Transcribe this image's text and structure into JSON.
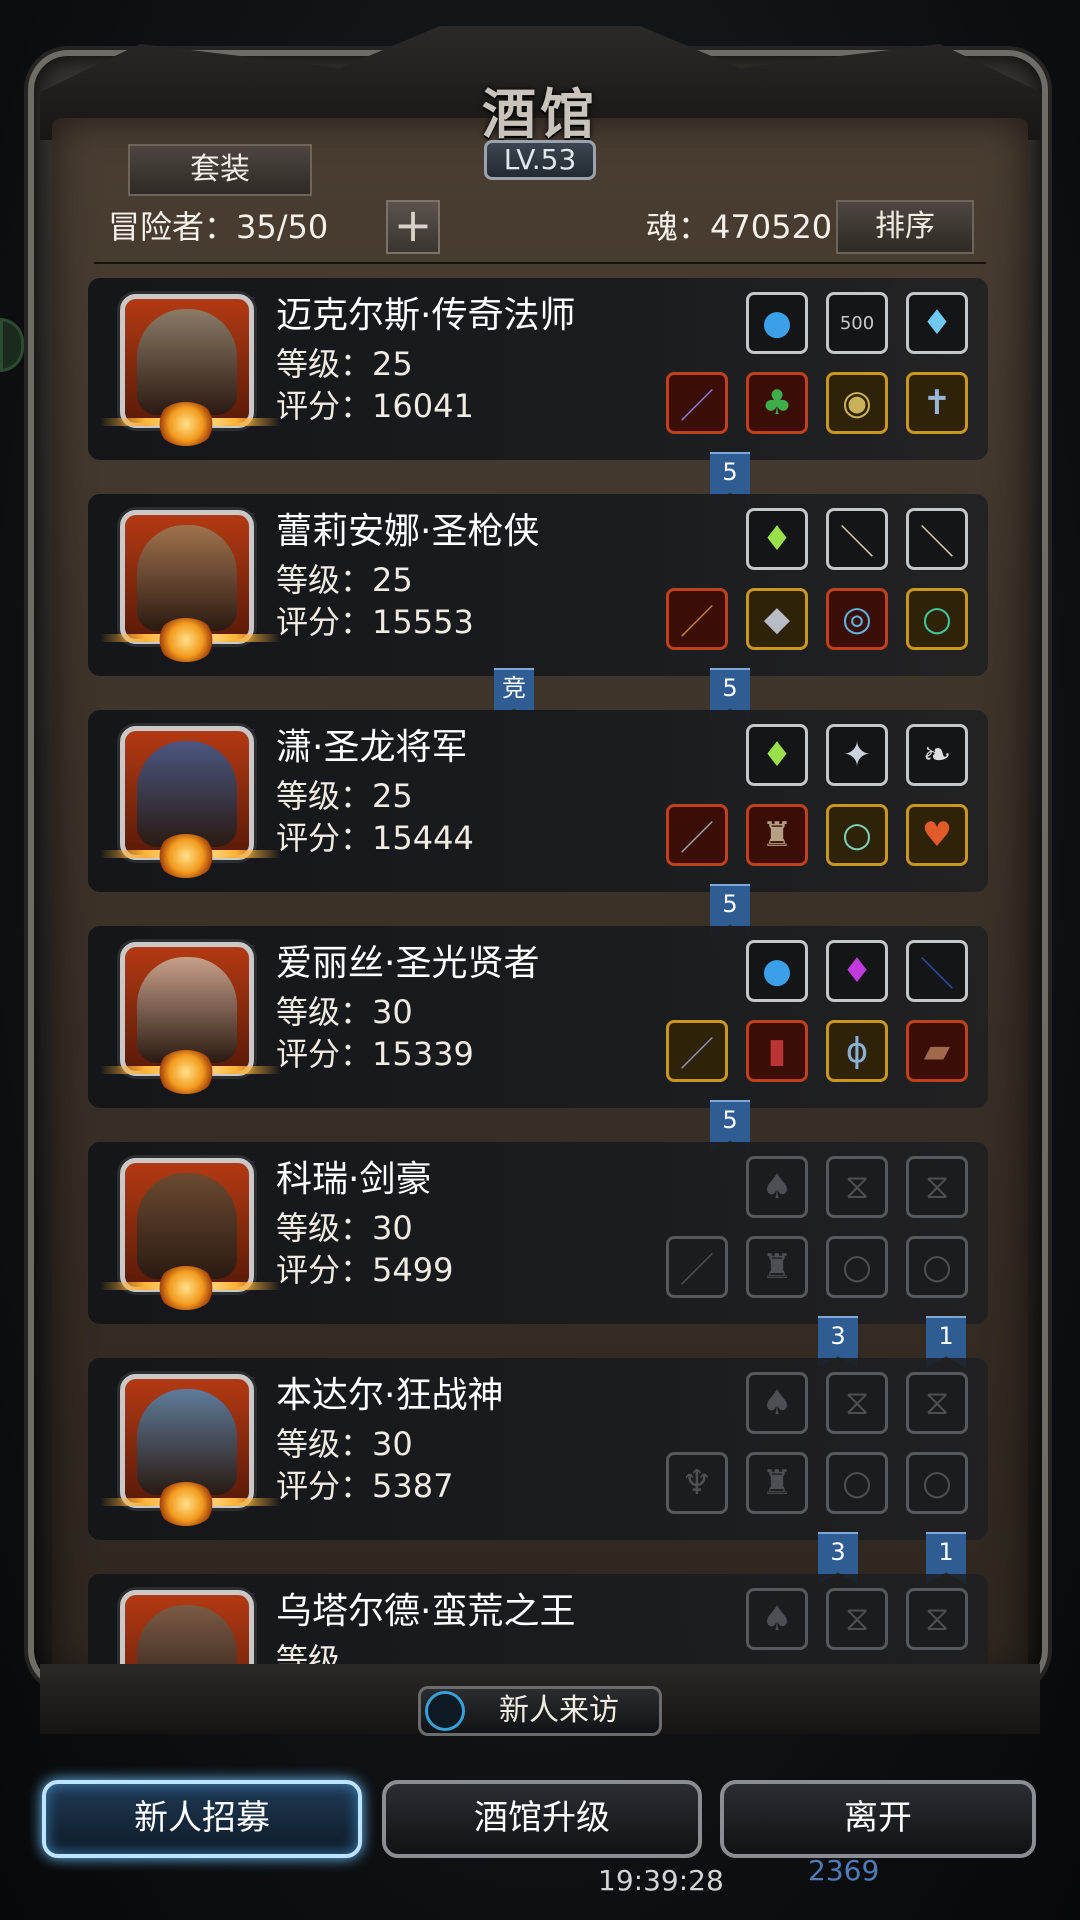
{
  "header": {
    "title": "酒馆",
    "level": "LV.53",
    "suit_button": "套装",
    "adventurers": "冒险者：35/50",
    "plus": "+",
    "soul": "魂：470520",
    "sort_button": "排序"
  },
  "heroes": [
    {
      "name": "迈克尔斯·传奇法师",
      "level": "等级：25",
      "score": "评分：16041",
      "face": "#8b7a66",
      "slots_top": [
        {
          "icon": "orb-icon",
          "glyph": "●",
          "style": "white",
          "color": "#3aa0e8"
        },
        {
          "icon": "badge-500-icon",
          "glyph": "500",
          "style": "white",
          "color": "#c9c9c9"
        },
        {
          "icon": "crystal-icon",
          "glyph": "♦",
          "style": "white",
          "color": "#6fc8f0"
        }
      ],
      "slots_bottom": [
        {
          "icon": "staff-icon",
          "glyph": "／",
          "style": "red",
          "color": "#8a7ad8"
        },
        {
          "icon": "robe-icon",
          "glyph": "♣",
          "style": "red",
          "color": "#3fae4a"
        },
        {
          "icon": "amulet-icon",
          "glyph": "◉",
          "style": "gold",
          "color": "#c9b25a"
        },
        {
          "icon": "cross-icon",
          "glyph": "✝",
          "style": "gold",
          "color": "#9bb5d6"
        }
      ],
      "ribbons": [
        "5"
      ]
    },
    {
      "name": "蕾莉安娜·圣枪侠",
      "level": "等级：25",
      "score": "评分：15553",
      "face": "#a0724e",
      "slots_top": [
        {
          "icon": "crystal-green-icon",
          "glyph": "♦",
          "style": "white",
          "color": "#9ae04a"
        },
        {
          "icon": "stick-icon",
          "glyph": "＼",
          "style": "white",
          "color": "#d8c9a6"
        },
        {
          "icon": "stick-icon",
          "glyph": "＼",
          "style": "white",
          "color": "#d8c9a6"
        }
      ],
      "slots_bottom": [
        {
          "icon": "gun-icon",
          "glyph": "／",
          "style": "red",
          "color": "#c97a3a"
        },
        {
          "icon": "armor-icon",
          "glyph": "◆",
          "style": "gold",
          "color": "#b8bcc4"
        },
        {
          "icon": "ring-icon",
          "glyph": "◎",
          "style": "red",
          "color": "#5fb3e0"
        },
        {
          "icon": "bracelet-icon",
          "glyph": "○",
          "style": "gold",
          "color": "#3ec99c"
        }
      ],
      "ribbons": [
        "竞",
        "5"
      ]
    },
    {
      "name": "潇·圣龙将军",
      "level": "等级：25",
      "score": "评分：15444",
      "face": "#4b5680",
      "slots_top": [
        {
          "icon": "crystal-green-icon",
          "glyph": "♦",
          "style": "white",
          "color": "#9ae04a"
        },
        {
          "icon": "emblem-icon",
          "glyph": "✦",
          "style": "white",
          "color": "#c9d3de"
        },
        {
          "icon": "claw-icon",
          "glyph": "❧",
          "style": "white",
          "color": "#ddd"
        }
      ],
      "slots_bottom": [
        {
          "icon": "sword-icon",
          "glyph": "／",
          "style": "red",
          "color": "#9aa0a6"
        },
        {
          "icon": "armor-icon",
          "glyph": "♜",
          "style": "red",
          "color": "#b59f85"
        },
        {
          "icon": "ring-icon",
          "glyph": "○",
          "style": "gold",
          "color": "#7dd0b3"
        },
        {
          "icon": "heart-amulet-icon",
          "glyph": "♥",
          "style": "gold",
          "color": "#e05a2a"
        }
      ],
      "ribbons": [
        "5"
      ]
    },
    {
      "name": "爱丽丝·圣光贤者",
      "level": "等级：30",
      "score": "评分：15339",
      "face": "#c8a08a",
      "slots_top": [
        {
          "icon": "orb-icon",
          "glyph": "●",
          "style": "white",
          "color": "#3aa0e8"
        },
        {
          "icon": "gem-purple-icon",
          "glyph": "♦",
          "style": "white",
          "color": "#c13ae0"
        },
        {
          "icon": "whip-icon",
          "glyph": "＼",
          "style": "white",
          "color": "#2a4fa0"
        }
      ],
      "slots_bottom": [
        {
          "icon": "scepter-icon",
          "glyph": "／",
          "style": "gold",
          "color": "#8d8fa6"
        },
        {
          "icon": "robe-icon",
          "glyph": "▮",
          "style": "red",
          "color": "#b33"
        },
        {
          "icon": "pendant-icon",
          "glyph": "ϕ",
          "style": "gold",
          "color": "#8ab0d6"
        },
        {
          "icon": "book-icon",
          "glyph": "▰",
          "style": "red",
          "color": "#a06a4a"
        }
      ],
      "ribbons": [
        "5"
      ]
    },
    {
      "name": "科瑞·剑豪",
      "level": "等级：30",
      "score": "评分：5499",
      "face": "#6b4a30",
      "slots_top": [
        {
          "icon": "flame-slot-icon",
          "glyph": "♠",
          "style": "gray",
          "color": "#4c5055"
        },
        {
          "icon": "empty-slot-icon",
          "glyph": "⧖",
          "style": "gray",
          "color": "#4c5055"
        },
        {
          "icon": "empty-slot-icon",
          "glyph": "⧖",
          "style": "gray",
          "color": "#4c5055"
        }
      ],
      "slots_bottom": [
        {
          "icon": "weapon-slot-icon",
          "glyph": "／",
          "style": "gray",
          "color": "#4c5055"
        },
        {
          "icon": "armor-slot-icon",
          "glyph": "♜",
          "style": "gray",
          "color": "#4c5055"
        },
        {
          "icon": "ring-slot-icon",
          "glyph": "○",
          "style": "gray",
          "color": "#4c5055"
        },
        {
          "icon": "ring-slot-icon",
          "glyph": "○",
          "style": "gray",
          "color": "#4c5055"
        }
      ],
      "ribbons": [
        "3",
        "1"
      ]
    },
    {
      "name": "本达尔·狂战神",
      "level": "等级：30",
      "score": "评分：5387",
      "face": "#5f7b9a",
      "slots_top": [
        {
          "icon": "flame-slot-icon",
          "glyph": "♠",
          "style": "gray",
          "color": "#4c5055"
        },
        {
          "icon": "empty-slot-icon",
          "glyph": "⧖",
          "style": "gray",
          "color": "#4c5055"
        },
        {
          "icon": "empty-slot-icon",
          "glyph": "⧖",
          "style": "gray",
          "color": "#4c5055"
        }
      ],
      "slots_bottom": [
        {
          "icon": "axe-slot-icon",
          "glyph": "♆",
          "style": "gray",
          "color": "#4c5055"
        },
        {
          "icon": "armor-slot-icon",
          "glyph": "♜",
          "style": "gray",
          "color": "#4c5055"
        },
        {
          "icon": "ring-slot-icon",
          "glyph": "○",
          "style": "gray",
          "color": "#4c5055"
        },
        {
          "icon": "ring-slot-icon",
          "glyph": "○",
          "style": "gray",
          "color": "#4c5055"
        }
      ],
      "ribbons": [
        "3",
        "1"
      ]
    },
    {
      "name": "乌塔尔德·蛮荒之王",
      "level": "等级",
      "score": "",
      "face": "#7a5a44",
      "slots_top": [
        {
          "icon": "flame-slot-icon",
          "glyph": "♠",
          "style": "gray",
          "color": "#4c5055"
        },
        {
          "icon": "empty-slot-icon",
          "glyph": "⧖",
          "style": "gray",
          "color": "#4c5055"
        },
        {
          "icon": "empty-slot-icon",
          "glyph": "⧖",
          "style": "gray",
          "color": "#4c5055"
        }
      ],
      "slots_bottom": [],
      "ribbons": []
    }
  ],
  "footer": {
    "visit": "新人来访",
    "recruit": "新人招募",
    "upgrade": "酒馆升级",
    "leave": "离开",
    "time": "19:39:28",
    "coins": "2369"
  }
}
